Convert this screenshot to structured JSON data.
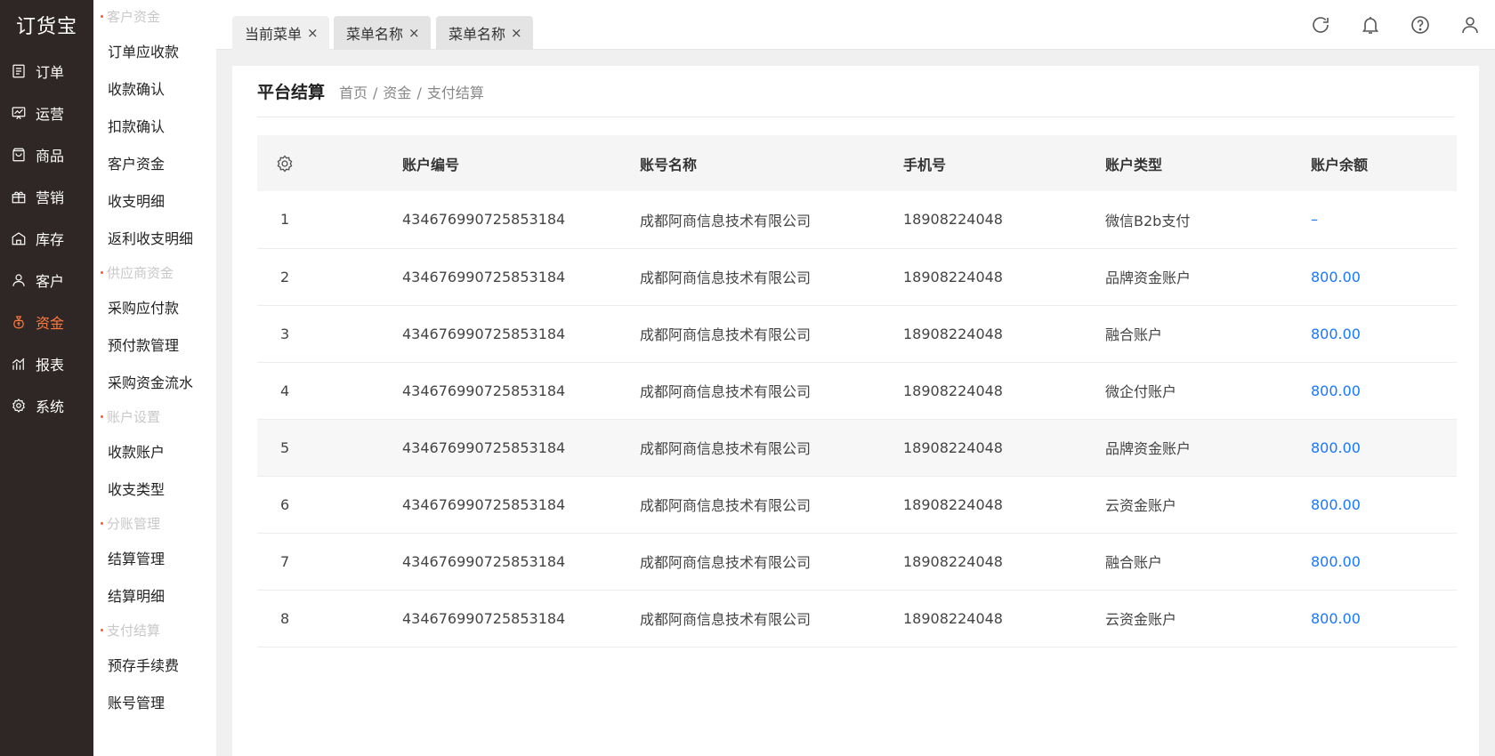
{
  "app": {
    "logo": "订货宝"
  },
  "nav": {
    "items": [
      {
        "label": "订单",
        "icon": "list-icon",
        "active": false
      },
      {
        "label": "运营",
        "icon": "chart-board-icon",
        "active": false
      },
      {
        "label": "商品",
        "icon": "bag-icon",
        "active": false
      },
      {
        "label": "营销",
        "icon": "gift-icon",
        "active": false
      },
      {
        "label": "库存",
        "icon": "warehouse-icon",
        "active": false
      },
      {
        "label": "客户",
        "icon": "user-icon",
        "active": false
      },
      {
        "label": "资金",
        "icon": "money-bag-icon",
        "active": true
      },
      {
        "label": "报表",
        "icon": "report-icon",
        "active": false
      },
      {
        "label": "系统",
        "icon": "gear-icon",
        "active": false
      }
    ],
    "active_color": "#ff7a3d"
  },
  "submenu": {
    "groups": [
      {
        "title": "客户资金",
        "items": [
          "订单应收款",
          "收款确认",
          "扣款确认",
          "客户资金",
          "收支明细",
          "返利收支明细"
        ]
      },
      {
        "title": "供应商资金",
        "items": [
          "采购应付款",
          "预付款管理",
          "采购资金流水"
        ]
      },
      {
        "title": "账户设置",
        "items": [
          "收款账户",
          "收支类型"
        ]
      },
      {
        "title": "分账管理",
        "items": [
          "结算管理",
          "结算明细"
        ]
      },
      {
        "title": "支付结算",
        "items": [
          "预存手续费",
          "账号管理"
        ]
      }
    ]
  },
  "tabs": [
    {
      "label": "当前菜单",
      "close": "×"
    },
    {
      "label": "菜单名称",
      "close": "×"
    },
    {
      "label": "菜单名称",
      "close": "×"
    }
  ],
  "page": {
    "title": "平台结算",
    "breadcrumb": [
      "首页",
      "资金",
      "支付结算"
    ],
    "breadcrumb_sep": "/"
  },
  "table": {
    "columns": [
      "账户编号",
      "账号名称",
      "手机号",
      "账户类型",
      "账户余额"
    ],
    "rows": [
      {
        "no": "1",
        "account_id": "434676990725853184",
        "name": "成都阿商信息技术有限公司",
        "phone": "18908224048",
        "type": "微信B2b支付",
        "balance": "–"
      },
      {
        "no": "2",
        "account_id": "434676990725853184",
        "name": "成都阿商信息技术有限公司",
        "phone": "18908224048",
        "type": "品牌资金账户",
        "balance": "800.00"
      },
      {
        "no": "3",
        "account_id": "434676990725853184",
        "name": "成都阿商信息技术有限公司",
        "phone": "18908224048",
        "type": "融合账户",
        "balance": "800.00"
      },
      {
        "no": "4",
        "account_id": "434676990725853184",
        "name": "成都阿商信息技术有限公司",
        "phone": "18908224048",
        "type": "微企付账户",
        "balance": "800.00"
      },
      {
        "no": "5",
        "account_id": "434676990725853184",
        "name": "成都阿商信息技术有限公司",
        "phone": "18908224048",
        "type": "品牌资金账户",
        "balance": "800.00"
      },
      {
        "no": "6",
        "account_id": "434676990725853184",
        "name": "成都阿商信息技术有限公司",
        "phone": "18908224048",
        "type": "云资金账户",
        "balance": "800.00"
      },
      {
        "no": "7",
        "account_id": "434676990725853184",
        "name": "成都阿商信息技术有限公司",
        "phone": "18908224048",
        "type": "融合账户",
        "balance": "800.00"
      },
      {
        "no": "8",
        "account_id": "434676990725853184",
        "name": "成都阿商信息技术有限公司",
        "phone": "18908224048",
        "type": "云资金账户",
        "balance": "800.00"
      }
    ],
    "balance_color": "#1677ff"
  },
  "topbar_icons": [
    "refresh-icon",
    "bell-icon",
    "help-icon",
    "user-icon"
  ]
}
